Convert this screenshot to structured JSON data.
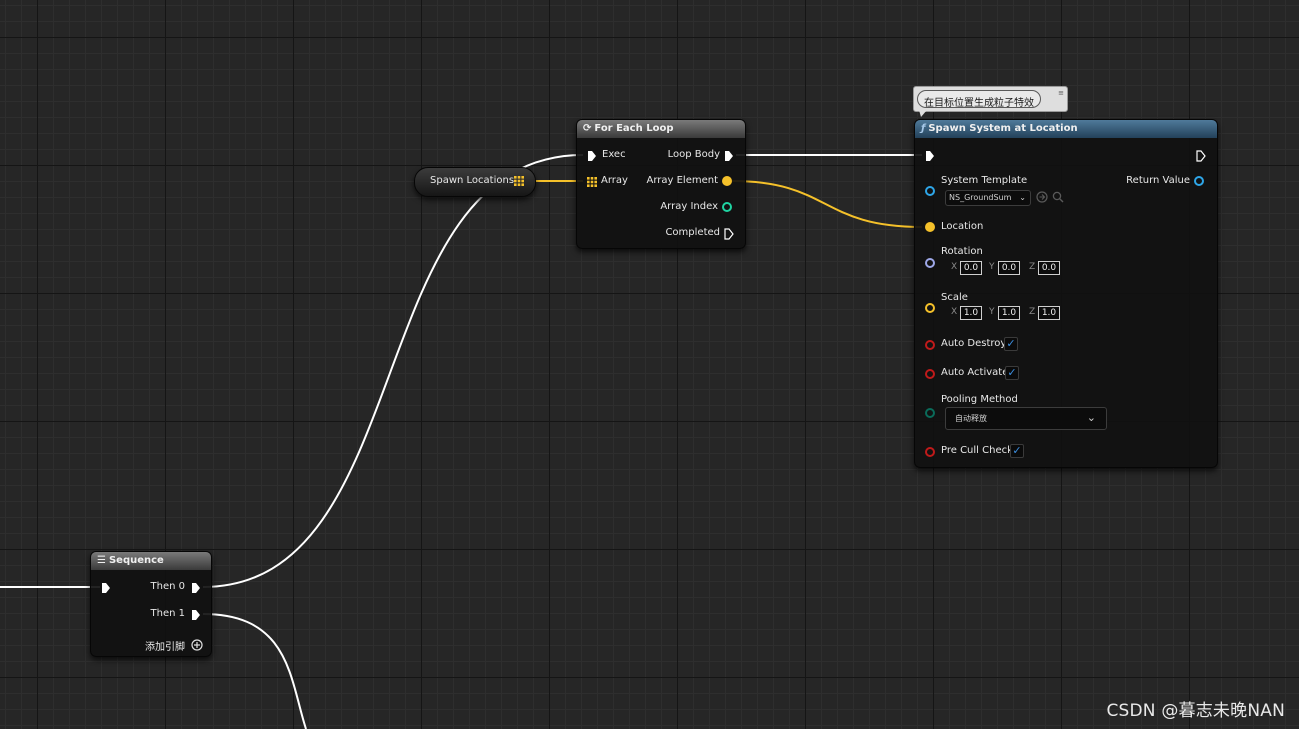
{
  "colors": {
    "exec": "#ffffff",
    "vector": "#f5c12a",
    "object": "#2ea6e8",
    "integer": "#1fd4a2",
    "rotator": "#9ea8e8",
    "boolean": "#c01a1a",
    "enum": "#0a6b5a",
    "header_function": "#3a6488"
  },
  "sequence_node": {
    "title": "Sequence",
    "icon": "sequence-icon",
    "pins": {
      "then0": "Then 0",
      "then1": "Then 1",
      "add_pin": "添加引脚"
    }
  },
  "spawn_locations_node": {
    "label": "Spawn Locations",
    "icon": "array-grid-icon"
  },
  "for_each_loop_node": {
    "title": "For Each Loop",
    "icon": "loop-icon",
    "pins": {
      "exec": "Exec",
      "array": "Array",
      "loop_body": "Loop Body",
      "array_element": "Array Element",
      "array_index": "Array Index",
      "completed": "Completed"
    }
  },
  "spawn_system_node": {
    "comment": "在目标位置生成粒子特效",
    "title": "Spawn System at Location",
    "icon": "function-icon",
    "pins": {
      "system_template": "System Template",
      "system_template_value": "NS_GroundSum",
      "return_value": "Return Value",
      "location": "Location",
      "rotation": "Rotation",
      "rotation_x": "0.0",
      "rotation_y": "0.0",
      "rotation_z": "0.0",
      "scale": "Scale",
      "scale_x": "1.0",
      "scale_y": "1.0",
      "scale_z": "1.0",
      "auto_destroy": "Auto Destroy",
      "auto_activate": "Auto Activate",
      "pooling_method": "Pooling Method",
      "pooling_method_value": "自动释放",
      "pre_cull_check": "Pre Cull Check"
    },
    "axis_labels": {
      "x": "X",
      "y": "Y",
      "z": "Z"
    },
    "checked": {
      "auto_destroy": true,
      "auto_activate": true,
      "pre_cull_check": true
    }
  },
  "watermark": "CSDN @暮志未晚NAN"
}
